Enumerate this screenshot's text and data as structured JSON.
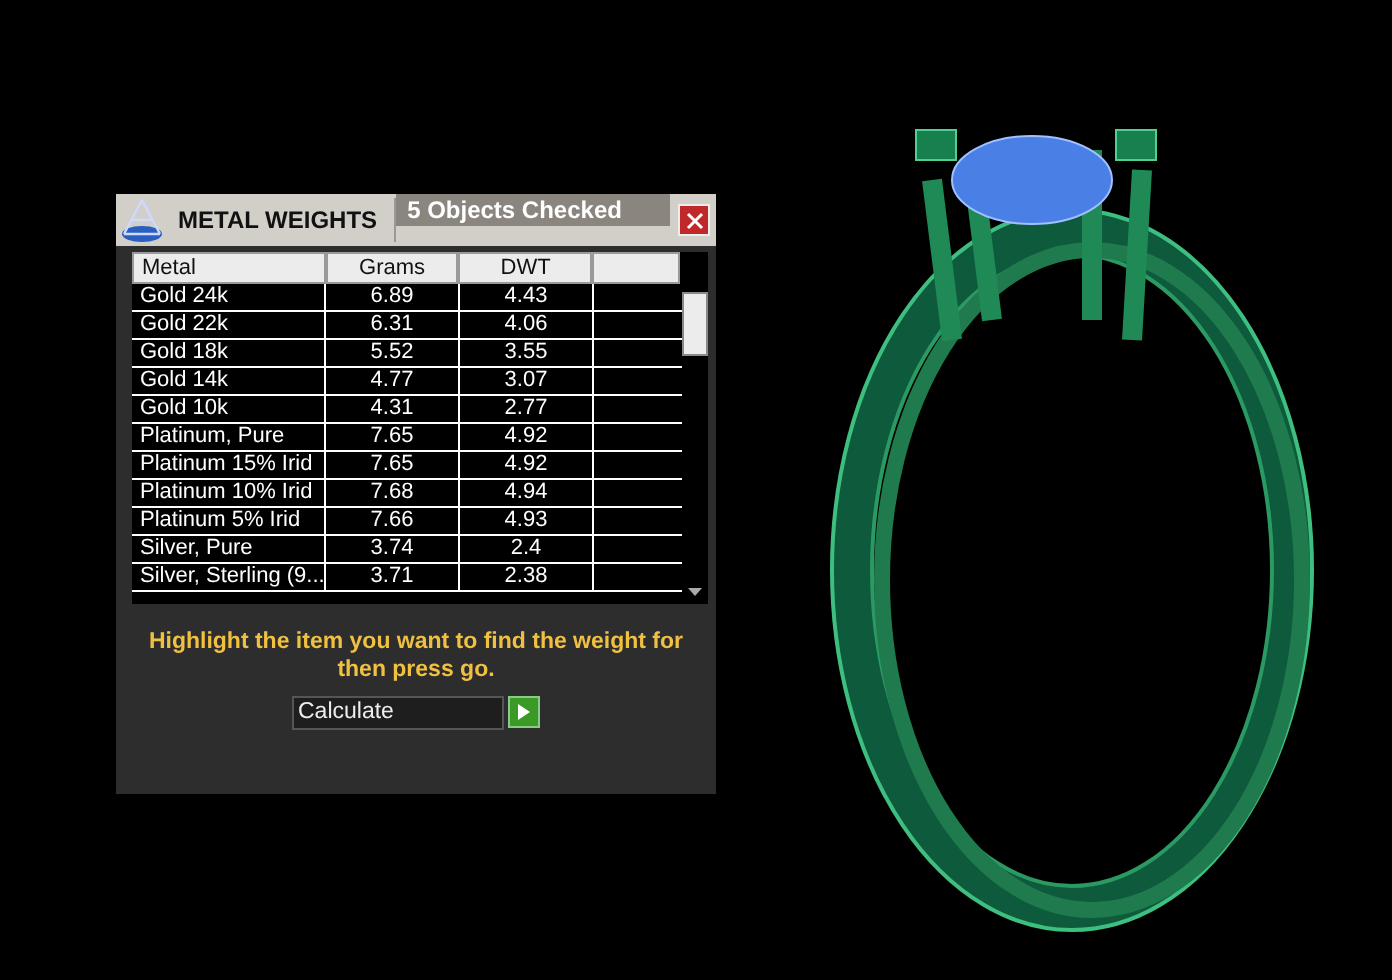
{
  "panel": {
    "title": "METAL WEIGHTS",
    "status": "5 Objects Checked"
  },
  "table": {
    "columns": [
      "Metal",
      "Grams",
      "DWT"
    ],
    "rows": [
      {
        "metal": "Gold 24k",
        "grams": "6.89",
        "dwt": "4.43"
      },
      {
        "metal": "Gold 22k",
        "grams": "6.31",
        "dwt": "4.06"
      },
      {
        "metal": "Gold 18k",
        "grams": "5.52",
        "dwt": "3.55"
      },
      {
        "metal": "Gold 14k",
        "grams": "4.77",
        "dwt": "3.07"
      },
      {
        "metal": "Gold 10k",
        "grams": "4.31",
        "dwt": "2.77"
      },
      {
        "metal": "Platinum, Pure",
        "grams": "7.65",
        "dwt": "4.92"
      },
      {
        "metal": "Platinum 15% Irid",
        "grams": "7.65",
        "dwt": "4.92"
      },
      {
        "metal": "Platinum 10% Irid",
        "grams": "7.68",
        "dwt": "4.94"
      },
      {
        "metal": "Platinum 5% Irid",
        "grams": "7.66",
        "dwt": "4.93"
      },
      {
        "metal": "Silver, Pure",
        "grams": "3.74",
        "dwt": "2.4"
      },
      {
        "metal": "Silver, Sterling (9...",
        "grams": "3.71",
        "dwt": "2.38"
      }
    ]
  },
  "instruction": "Highlight the item you want to find the weight for then press go.",
  "action": {
    "value": "Calculate"
  }
}
